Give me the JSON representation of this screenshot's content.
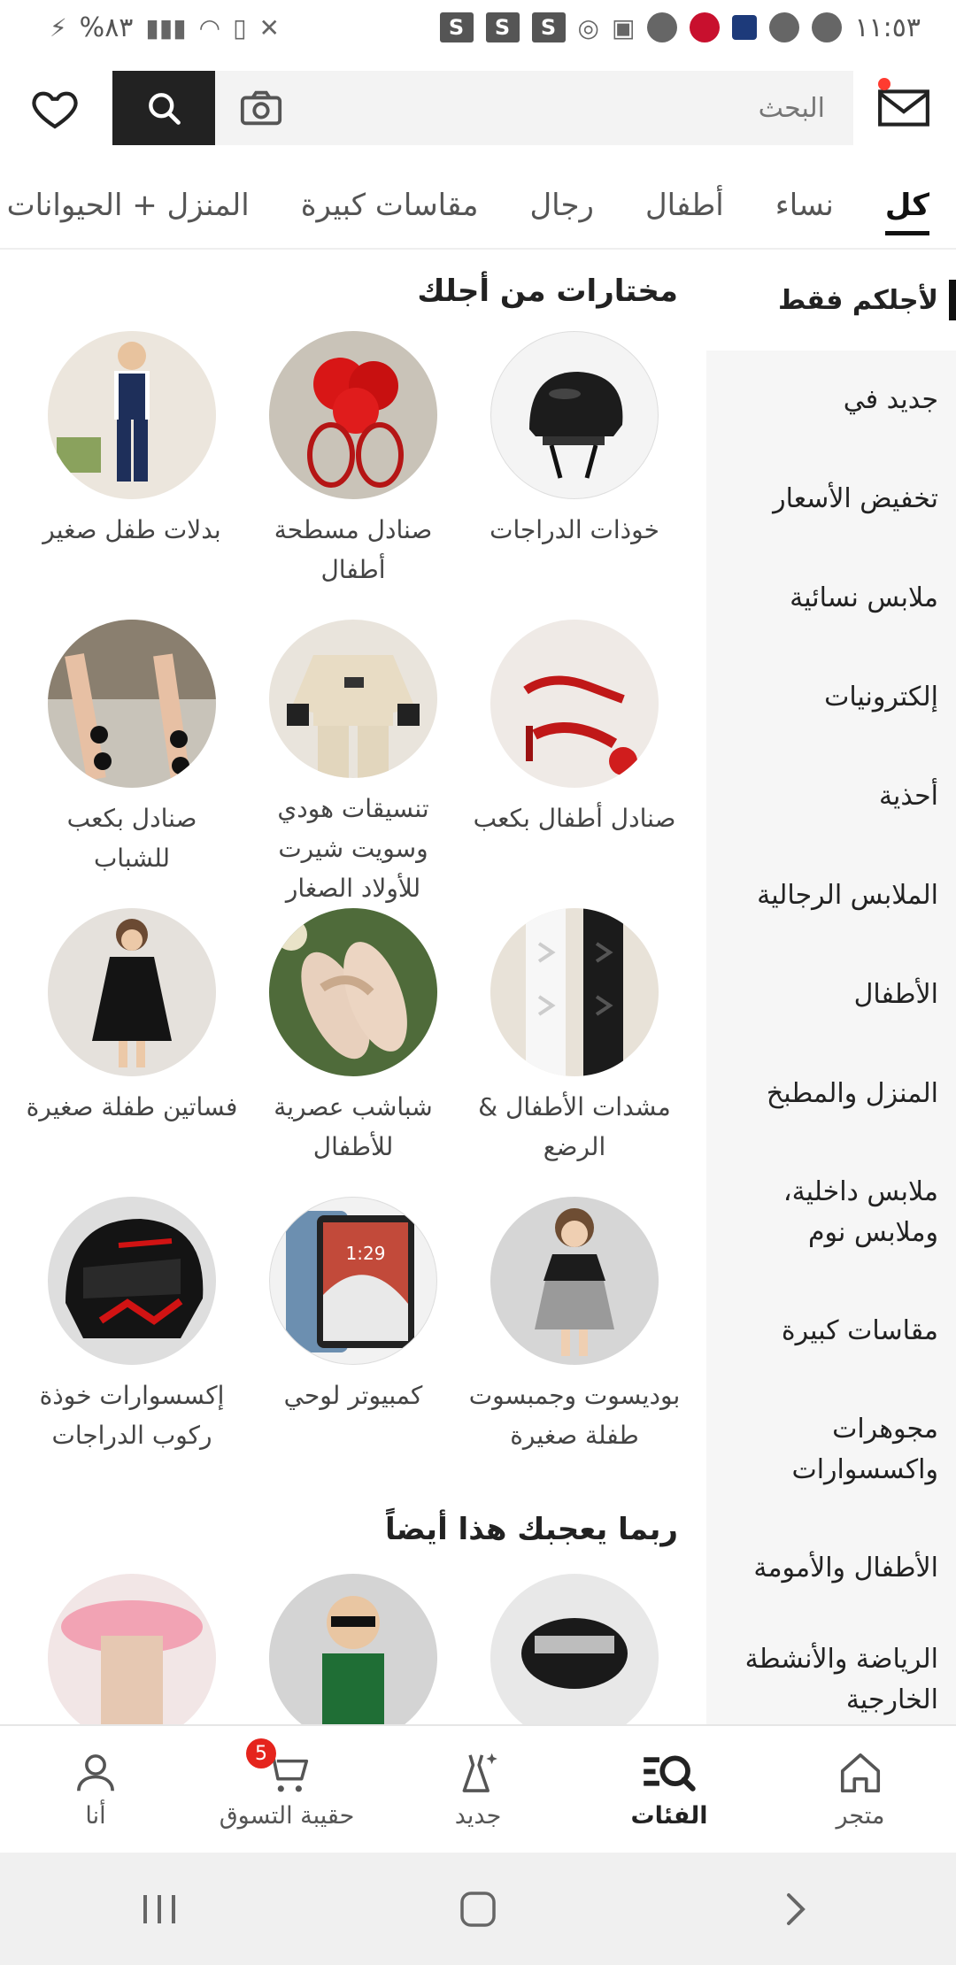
{
  "status_bar": {
    "time": "١١:٥٣",
    "battery": "%٨٣",
    "icons": [
      "charging-icon",
      "signal-icon",
      "wifi-icon",
      "battery-saver-icon",
      "mute-icon",
      "s-app-icon",
      "incognito-icon",
      "gallery-icon",
      "snapchat-icon",
      "call-icon",
      "app-icon",
      "music-icon"
    ],
    "s_label": "S"
  },
  "search": {
    "placeholder": "البحث"
  },
  "top_tabs": [
    "كل",
    "نساء",
    "أطفال",
    "رجال",
    "مقاسات كبيرة",
    "المنزل + الحيوانات"
  ],
  "sidebar": {
    "items": [
      "لأجلكم فقط",
      "جديد في",
      "تخفيض الأسعار",
      "ملابس نسائية",
      "إلكترونيات",
      "أحذية",
      "الملابس الرجالية",
      "الأطفال",
      "المنزل والمطبخ",
      "ملابس داخلية، وملابس نوم",
      "مقاسات كبيرة",
      "مجوهرات واكسسوارات",
      "الأطفال والأمومة",
      "الرياضة والأنشطة الخارجية"
    ]
  },
  "main": {
    "section_title": "مختارات من أجلك",
    "categories": [
      {
        "label": "خوذات الدراجات",
        "icon": "helmet"
      },
      {
        "label": "صنادل مسطحة أطفال",
        "icon": "red-sandals"
      },
      {
        "label": "بدلات طفل صغير",
        "icon": "boy-suit"
      },
      {
        "label": "صنادل أطفال بكعب",
        "icon": "heel-sandals"
      },
      {
        "label": "تنسيقات هودي وسويت شيرت للأولاد الصغار",
        "icon": "hoodie-set"
      },
      {
        "label": "صنادل بكعب للشباب",
        "icon": "black-heels"
      },
      {
        "label": "مشدات الأطفال & الرضع",
        "icon": "tights"
      },
      {
        "label": "شباشب عصرية للأطفال",
        "icon": "slippers"
      },
      {
        "label": "فساتين طفلة صغيرة",
        "icon": "girl-dress"
      },
      {
        "label": "بوديسوت وجمبسوت طفلة صغيرة",
        "icon": "bodysuit"
      },
      {
        "label": "كمبيوتر لوحي",
        "icon": "tablet"
      },
      {
        "label": "إكسسوارات خوذة ركوب الدراجات",
        "icon": "moto-helmet"
      }
    ],
    "more_title": "ربما يعجبك هذا أيضاً",
    "tablet_time": "1:29"
  },
  "bottom_nav": {
    "items": [
      {
        "label": "أنا",
        "icon": "person-icon"
      },
      {
        "label": "حقيبة التسوق",
        "icon": "cart-icon"
      },
      {
        "label": "جديد",
        "icon": "dress-sparkle-icon"
      },
      {
        "label": "الفئات",
        "icon": "categories-icon"
      },
      {
        "label": "متجر",
        "icon": "home-icon"
      }
    ],
    "cart_badge": "5",
    "active": "الفئات"
  },
  "colors": {
    "accent_dark": "#222222",
    "badge_red": "#e5241d",
    "sidebar_bg": "#f6f6f6"
  }
}
